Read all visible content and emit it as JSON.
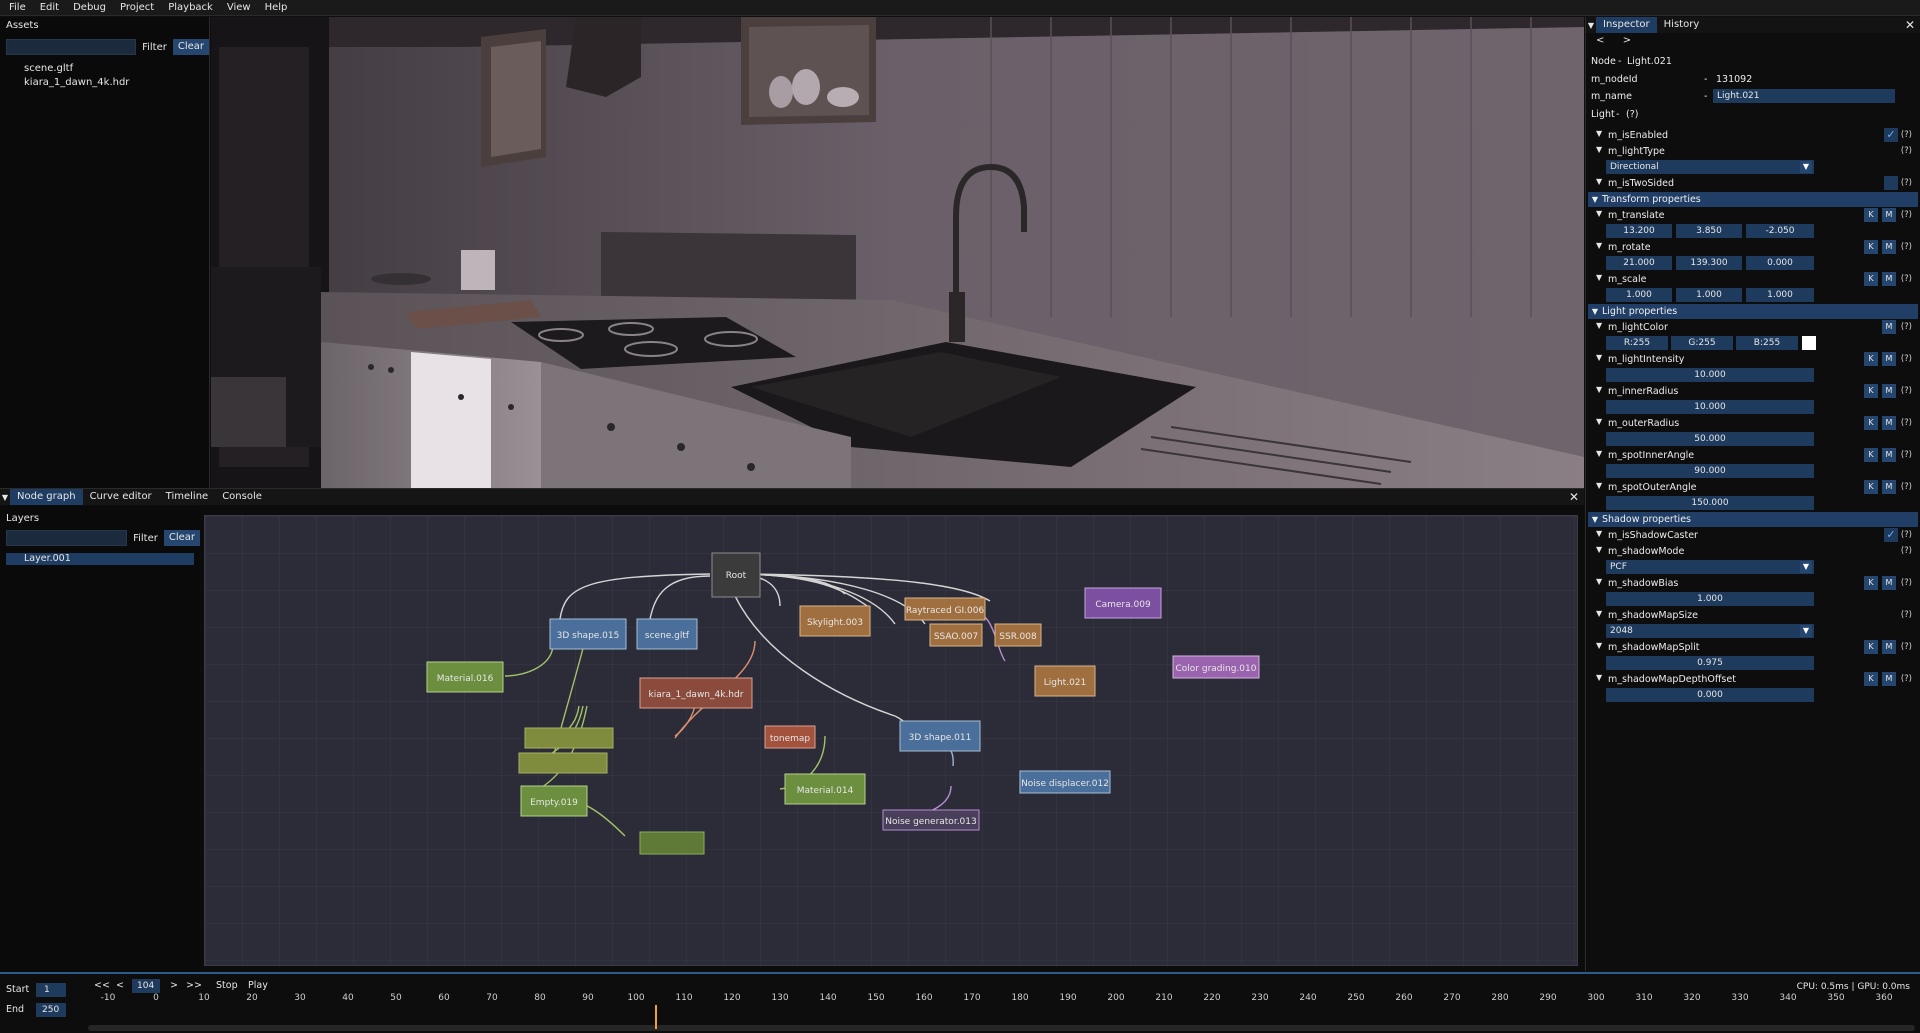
{
  "menu": [
    "File",
    "Edit",
    "Debug",
    "Project",
    "Playback",
    "View",
    "Help"
  ],
  "assets": {
    "title": "Assets",
    "filter_label": "Filter",
    "clear_label": "Clear",
    "items": [
      "scene.gltf",
      "kiara_1_dawn_4k.hdr"
    ]
  },
  "inspector": {
    "tabs": [
      "Inspector",
      "History"
    ],
    "nav": [
      "<",
      ">"
    ],
    "node_header": "Node",
    "node_name_header": "Light.021",
    "node_id_label": "m_nodeId",
    "node_id_value": "131092",
    "name_label": "m_name",
    "name_value": "Light.021",
    "light_header": "Light",
    "help": "(?)",
    "k": "K",
    "m": "M",
    "enabled_label": "m_isEnabled",
    "light_type_label": "m_lightType",
    "light_type_value": "Directional",
    "two_sided_label": "m_isTwoSided",
    "transform_section": "Transform properties",
    "translate_label": "m_translate",
    "translate": [
      "13.200",
      "3.850",
      "-2.050"
    ],
    "rotate_label": "m_rotate",
    "rotate": [
      "21.000",
      "139.300",
      "0.000"
    ],
    "scale_label": "m_scale",
    "scale": [
      "1.000",
      "1.000",
      "1.000"
    ],
    "light_section": "Light properties",
    "color_label": "m_lightColor",
    "color": [
      "R:255",
      "G:255",
      "B:255"
    ],
    "intensity_label": "m_lightIntensity",
    "intensity": "10.000",
    "inner_radius_label": "m_innerRadius",
    "inner_radius": "10.000",
    "outer_radius_label": "m_outerRadius",
    "outer_radius": "50.000",
    "spot_inner_label": "m_spotInnerAngle",
    "spot_inner": "90.000",
    "spot_outer_label": "m_spotOuterAngle",
    "spot_outer": "150.000",
    "shadow_section": "Shadow properties",
    "shadow_caster_label": "m_isShadowCaster",
    "shadow_mode_label": "m_shadowMode",
    "shadow_mode": "PCF",
    "shadow_bias_label": "m_shadowBias",
    "shadow_bias": "1.000",
    "shadow_map_size_label": "m_shadowMapSize",
    "shadow_map_size": "2048",
    "shadow_map_split_label": "m_shadowMapSplit",
    "shadow_map_split": "0.975",
    "shadow_depth_offset_label": "m_shadowMapDepthOffset",
    "shadow_depth_offset": "0.000"
  },
  "dock": {
    "tabs": [
      "Node graph",
      "Curve editor",
      "Timeline",
      "Console"
    ],
    "layers_title": "Layers",
    "filter_label": "Filter",
    "clear_label": "Clear",
    "layer_item": "Layer.001"
  },
  "graph": {
    "nodes": {
      "root": "Root",
      "shape015": "3D shape.015",
      "scene": "scene.gltf",
      "skylight": "Skylight.003",
      "raytraced": "Raytraced GI.006",
      "ssao": "SSAO.007",
      "ssr": "SSR.008",
      "camera": "Camera.009",
      "colorgrading": "Color grading.010",
      "light": "Light.021",
      "material016": "Material.016",
      "hdr": "kiara_1_dawn_4k.hdr",
      "tonemap": "tonemap",
      "shape011": "3D shape.011",
      "noisedisp": "Noise displacer.012",
      "material014": "Material.014",
      "noisegen": "Noise generator.013",
      "empty": "Empty.019"
    },
    "colors": {
      "shape": "#4a6f9a",
      "material": "#6b8f3f",
      "orange": "#a06f3f",
      "camera": "#7d4fa0",
      "grading": "#9a63ae",
      "red": "#a3523d",
      "root": "#3b3b3b"
    }
  },
  "timeline": {
    "start_label": "Start",
    "start_value": "1",
    "end_label": "End",
    "end_value": "250",
    "controls": [
      "<<",
      "<",
      ">",
      ">>"
    ],
    "current_frame": "104",
    "stop_label": "Stop",
    "play_label": "Play",
    "perf": "CPU: 0.5ms | GPU: 0.0ms",
    "ticks": [
      "-10",
      "0",
      "10",
      "20",
      "30",
      "40",
      "50",
      "60",
      "70",
      "80",
      "90",
      "100",
      "110",
      "120",
      "130",
      "140",
      "150",
      "160",
      "170",
      "180",
      "190",
      "200",
      "210",
      "220",
      "230",
      "240",
      "250",
      "260",
      "270",
      "280",
      "290",
      "300",
      "310",
      "320",
      "330",
      "340",
      "350",
      "360"
    ]
  }
}
